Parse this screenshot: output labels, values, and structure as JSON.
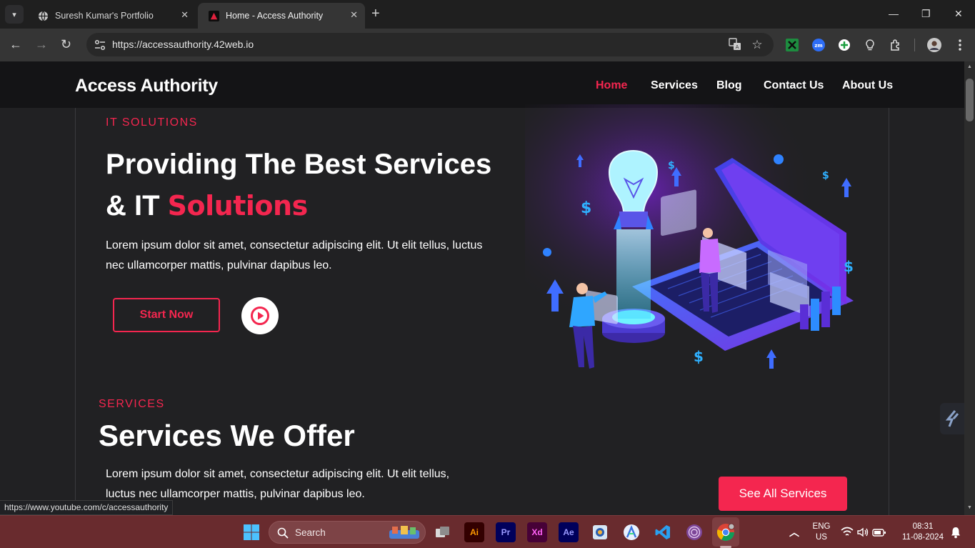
{
  "browser": {
    "tabs": [
      {
        "title": "Suresh Kumar's Portfolio",
        "active": false
      },
      {
        "title": "Home - Access Authority",
        "active": true
      }
    ],
    "url": "https://accessauthority.42web.io",
    "status_url": "https://www.youtube.com/c/accessauthority"
  },
  "site": {
    "brand": "Access Authority",
    "nav": [
      "Home",
      "Services",
      "Blog",
      "Contact Us",
      "About Us"
    ],
    "hero": {
      "eyebrow": "IT SOLUTIONS",
      "title_line1": "Providing The Best Services",
      "title_line2_prefix": "& IT ",
      "title_line2_accent": "Solutions",
      "paragraph_line1": "Lorem ipsum dolor sit amet, consectetur adipiscing elit. Ut elit tellus, luctus",
      "paragraph_line2": "nec ullamcorper mattis, pulvinar dapibus leo.",
      "cta_label": "Start Now"
    },
    "services": {
      "eyebrow": "SERVICES",
      "title": "Services We Offer",
      "paragraph_line1": "Lorem ipsum dolor sit amet, consectetur adipiscing elit. Ut elit tellus,",
      "paragraph_line2": "luctus nec ullamcorper mattis, pulvinar dapibus leo.",
      "cta_label": "See All Services"
    }
  },
  "taskbar": {
    "search_placeholder": "Search",
    "apps": [
      "Ai",
      "Pr",
      "Xd",
      "Ae"
    ],
    "language": "ENG",
    "region": "US",
    "time": "08:31",
    "date": "11-08-2024"
  },
  "colors": {
    "accent": "#f4264f",
    "page_bg": "#212123",
    "header_bg": "#141416",
    "taskbar_bg": "#692b2e"
  }
}
